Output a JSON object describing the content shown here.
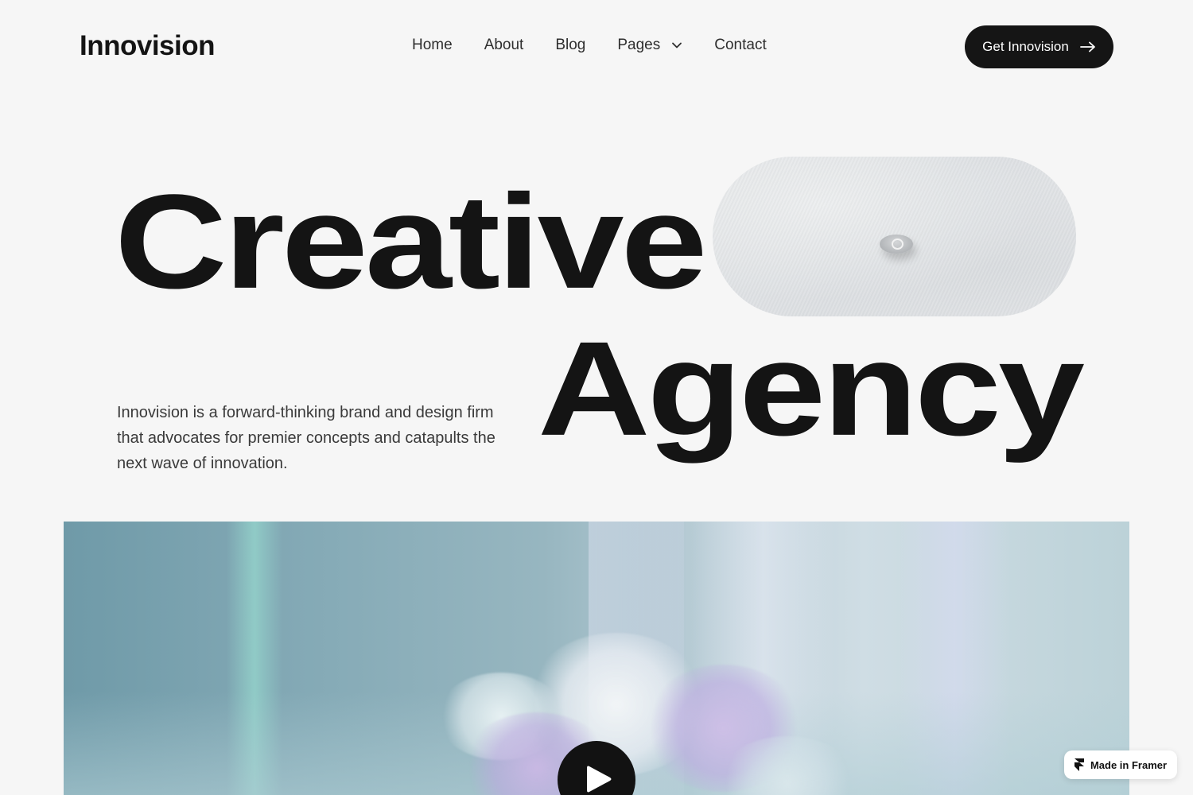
{
  "brand": {
    "logo_text": "Innovision"
  },
  "nav": {
    "items": [
      {
        "label": "Home"
      },
      {
        "label": "About"
      },
      {
        "label": "Blog"
      },
      {
        "label": "Pages",
        "has_dropdown": true
      },
      {
        "label": "Contact"
      }
    ]
  },
  "cta": {
    "label": "Get Innovision",
    "icon": "arrow-right-icon"
  },
  "hero": {
    "headline_line1": "Creative",
    "headline_line2": "Agency",
    "description": "Innovision is a forward-thinking brand and design firm that advocates for premier concepts and catapults the next wave of innovation."
  },
  "media": {
    "play_icon": "play-icon"
  },
  "badge": {
    "label": "Made in Framer",
    "icon": "framer-icon"
  },
  "colors": {
    "background": "#f6f6f6",
    "text": "#141414",
    "button_bg": "#151515",
    "button_text": "#ffffff"
  }
}
